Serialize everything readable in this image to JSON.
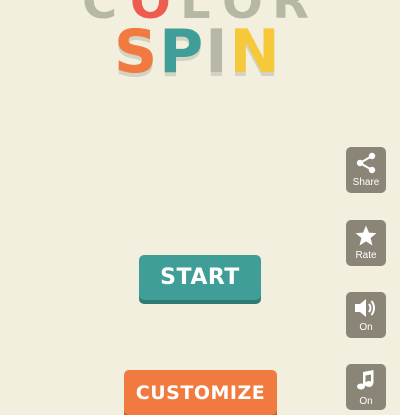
{
  "logo": {
    "top_letters": [
      {
        "ch": "C",
        "color": "#b6b8a5"
      },
      {
        "ch": "O",
        "color": "#ee5c4e"
      },
      {
        "ch": "L",
        "color": "#b6b8a5"
      },
      {
        "ch": "O",
        "color": "#b6b8a5"
      },
      {
        "ch": "R",
        "color": "#b6b8a5"
      }
    ],
    "main_letters": [
      {
        "ch": "S",
        "color": "#f07a3f"
      },
      {
        "ch": "P",
        "color": "#3f9e97"
      },
      {
        "ch": "I",
        "color": "#b6b8a5"
      },
      {
        "ch": "N",
        "color": "#f6c93a"
      }
    ]
  },
  "buttons": {
    "start_label": "START",
    "customize_label": "CUSTOMIZE"
  },
  "side_menu": {
    "share_label": "Share",
    "rate_label": "Rate",
    "sound_label": "On",
    "music_label": "On"
  },
  "colors": {
    "background": "#f2efdf",
    "start": "#3f9e97",
    "customize": "#f07a3f",
    "side_button": "#8b8578"
  }
}
